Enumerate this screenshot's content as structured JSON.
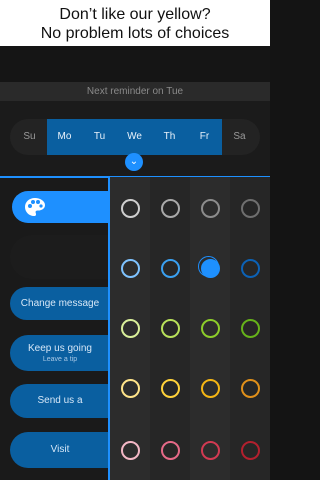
{
  "banner": {
    "line1": "Don’t like our yellow?",
    "line2": "No problem lots of choices"
  },
  "reminder": {
    "text": "Next reminder on Tue"
  },
  "days": [
    {
      "label": "Su",
      "selected": false
    },
    {
      "label": "Mo",
      "selected": true
    },
    {
      "label": "Tu",
      "selected": true
    },
    {
      "label": "We",
      "selected": true
    },
    {
      "label": "Th",
      "selected": true
    },
    {
      "label": "Fr",
      "selected": true
    },
    {
      "label": "Sa",
      "selected": false
    }
  ],
  "menu": {
    "change_message": "Change message",
    "keep_us_going": "Keep us going",
    "leave_tip": "Leave a tip",
    "send_us": "Send us a",
    "visit": "Visit"
  },
  "colors": {
    "accent": "#1e90ff",
    "selected_day": "#0a5fa0",
    "picker_rows": [
      [
        "#cfcfcf",
        "#a9a9a9",
        "#8c8c8c",
        "#6f6f6f"
      ],
      [
        "#7fc3ff",
        "#3aa0f0",
        "#1e90ff",
        "#0c62b6"
      ],
      [
        "#d9ef9a",
        "#b8e05a",
        "#8dcc2a",
        "#66b21a"
      ],
      [
        "#ffe48a",
        "#ffd23a",
        "#f5b614",
        "#e0901a"
      ],
      [
        "#f4b8c6",
        "#e66a88",
        "#d23a52",
        "#b3202e"
      ]
    ],
    "selected_swatch": "#1e90ff"
  }
}
